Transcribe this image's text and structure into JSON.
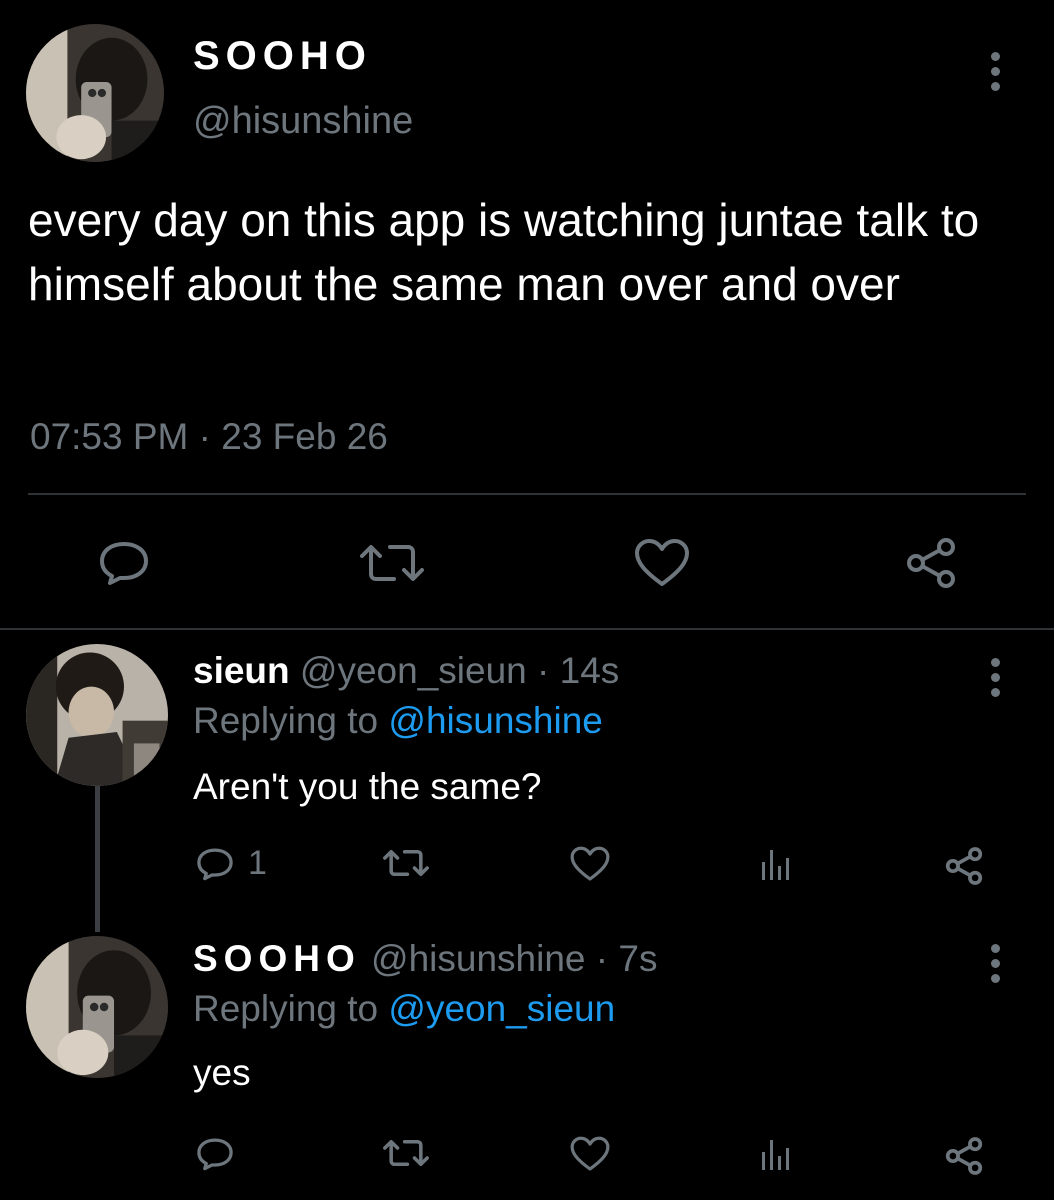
{
  "main_tweet": {
    "display_name": "SOOHO",
    "handle": "@hisunshine",
    "text": "every day on this app is watching juntae talk to himself about the same man over and over",
    "timestamp": "07:53 PM · 23 Feb 26",
    "actions": [
      "reply-icon",
      "retweet-icon",
      "like-icon",
      "share-icon"
    ]
  },
  "replies": [
    {
      "display_name": "sieun",
      "handle": "@yeon_sieun",
      "time": "· 14s",
      "replying_prefix": "Replying to",
      "replying_to": "@hisunshine",
      "text": "Aren't you the same?",
      "reply_count": "1"
    },
    {
      "display_name": "SOOHO",
      "handle": "@hisunshine",
      "time": "· 7s",
      "replying_prefix": "Replying to",
      "replying_to": "@yeon_sieun",
      "text": "yes",
      "reply_count": ""
    }
  ],
  "colors": {
    "background": "#000000",
    "primary_text": "#ffffff",
    "secondary_text": "#6e767d",
    "mention": "#1d9bf0",
    "divider": "#2f3336"
  }
}
